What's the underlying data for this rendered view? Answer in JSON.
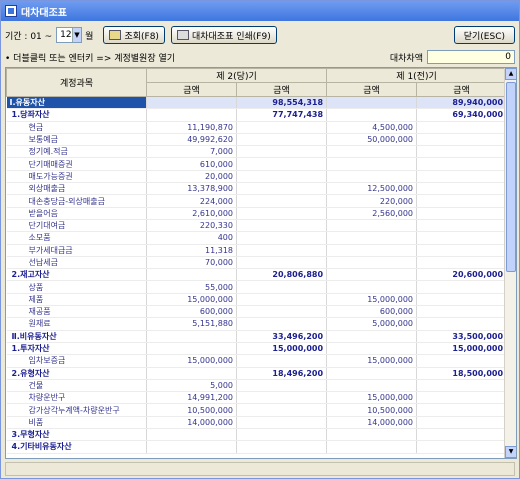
{
  "window": {
    "title": "대차대조표"
  },
  "toolbar": {
    "period_label": "기간 : 01 ~",
    "month_value": "12",
    "month_unit": "월",
    "search_label": "조회(F8)",
    "print_label": "대차대조표 인쇄(F9)",
    "close_label": "닫기(ESC)",
    "icons": {
      "search": "search-icon",
      "print": "printer-icon"
    }
  },
  "hint": {
    "text": "• 더블클릭 또는 엔터키 => 계정별원장 열기",
    "diff_label": "대차차액",
    "diff_value": "0"
  },
  "table": {
    "col_account": "계정과목",
    "period_current": "제 2(당)기",
    "period_prior": "제 1(전)기",
    "amount_label": "금액",
    "rows": [
      {
        "type": "cat1",
        "account": "Ⅰ.유동자산",
        "c1": "",
        "c2": "98,554,318",
        "p1": "",
        "p2": "89,940,000"
      },
      {
        "type": "cat2",
        "account": "1.당좌자산",
        "c1": "",
        "c2": "77,747,438",
        "p1": "",
        "p2": "69,340,000"
      },
      {
        "type": "item",
        "account": "현금",
        "c1": "11,190,870",
        "c2": "",
        "p1": "4,500,000",
        "p2": ""
      },
      {
        "type": "item",
        "account": "보통예금",
        "c1": "49,992,620",
        "c2": "",
        "p1": "50,000,000",
        "p2": ""
      },
      {
        "type": "item",
        "account": "정기예.적금",
        "c1": "7,000",
        "c2": "",
        "p1": "",
        "p2": ""
      },
      {
        "type": "item",
        "account": "단기매매증권",
        "c1": "610,000",
        "c2": "",
        "p1": "",
        "p2": ""
      },
      {
        "type": "item",
        "account": "매도가능증권",
        "c1": "20,000",
        "c2": "",
        "p1": "",
        "p2": ""
      },
      {
        "type": "item",
        "account": "외상매출금",
        "c1": "13,378,900",
        "c2": "",
        "p1": "12,500,000",
        "p2": ""
      },
      {
        "type": "item",
        "account": "대손충당금-외상매출금",
        "c1": "224,000",
        "c2": "",
        "p1": "220,000",
        "p2": ""
      },
      {
        "type": "item",
        "account": "받을어음",
        "c1": "2,610,000",
        "c2": "",
        "p1": "2,560,000",
        "p2": ""
      },
      {
        "type": "item",
        "account": "단기대여금",
        "c1": "220,330",
        "c2": "",
        "p1": "",
        "p2": ""
      },
      {
        "type": "item",
        "account": "소모품",
        "c1": "400",
        "c2": "",
        "p1": "",
        "p2": ""
      },
      {
        "type": "item",
        "account": "부가세대급금",
        "c1": "11,318",
        "c2": "",
        "p1": "",
        "p2": ""
      },
      {
        "type": "item",
        "account": "선납세금",
        "c1": "70,000",
        "c2": "",
        "p1": "",
        "p2": ""
      },
      {
        "type": "cat2",
        "account": "2.재고자산",
        "c1": "",
        "c2": "20,806,880",
        "p1": "",
        "p2": "20,600,000"
      },
      {
        "type": "item",
        "account": "상품",
        "c1": "55,000",
        "c2": "",
        "p1": "",
        "p2": ""
      },
      {
        "type": "item",
        "account": "제품",
        "c1": "15,000,000",
        "c2": "",
        "p1": "15,000,000",
        "p2": ""
      },
      {
        "type": "item",
        "account": "재공품",
        "c1": "600,000",
        "c2": "",
        "p1": "600,000",
        "p2": ""
      },
      {
        "type": "item",
        "account": "원재료",
        "c1": "5,151,880",
        "c2": "",
        "p1": "5,000,000",
        "p2": ""
      },
      {
        "type": "cat2",
        "account": "Ⅱ.비유동자산",
        "c1": "",
        "c2": "33,496,200",
        "p1": "",
        "p2": "33,500,000"
      },
      {
        "type": "cat2",
        "account": "1.투자자산",
        "c1": "",
        "c2": "15,000,000",
        "p1": "",
        "p2": "15,000,000"
      },
      {
        "type": "item",
        "account": "임차보증금",
        "c1": "15,000,000",
        "c2": "",
        "p1": "15,000,000",
        "p2": ""
      },
      {
        "type": "cat2",
        "account": "2.유형자산",
        "c1": "",
        "c2": "18,496,200",
        "p1": "",
        "p2": "18,500,000"
      },
      {
        "type": "item",
        "account": "건물",
        "c1": "5,000",
        "c2": "",
        "p1": "",
        "p2": ""
      },
      {
        "type": "item",
        "account": "차량운반구",
        "c1": "14,991,200",
        "c2": "",
        "p1": "15,000,000",
        "p2": ""
      },
      {
        "type": "item",
        "account": "감가상각누계액-차량운반구",
        "c1": "10,500,000",
        "c2": "",
        "p1": "10,500,000",
        "p2": ""
      },
      {
        "type": "item",
        "account": "비품",
        "c1": "14,000,000",
        "c2": "",
        "p1": "14,000,000",
        "p2": ""
      },
      {
        "type": "cat2",
        "account": "3.무형자산",
        "c1": "",
        "c2": "",
        "p1": "",
        "p2": ""
      },
      {
        "type": "cat2",
        "account": "4.기타비유동자산",
        "c1": "",
        "c2": "",
        "p1": "",
        "p2": ""
      }
    ]
  }
}
